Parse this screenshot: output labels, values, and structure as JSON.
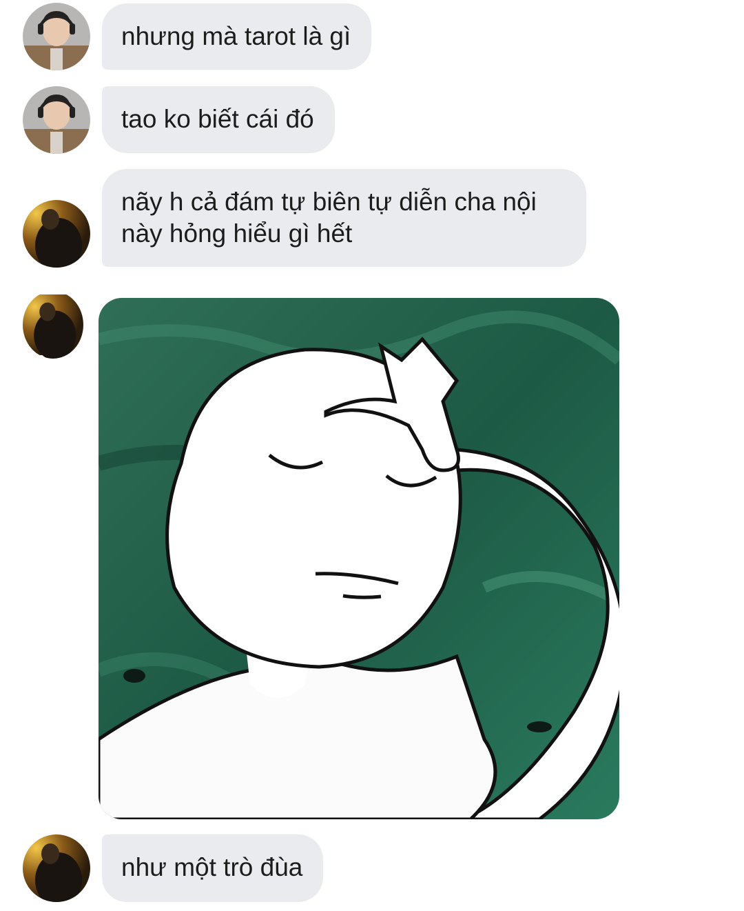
{
  "messages": [
    {
      "sender": "friend",
      "text": "nhưng mà tarot là gì"
    },
    {
      "sender": "friend",
      "text": "tao ko biết cái đó"
    },
    {
      "sender": "self",
      "lines": [
        "nãy h cả đám tự biên tự diễn cha nội",
        "này hỏng hiểu gì hết"
      ]
    },
    {
      "sender": "self",
      "type": "sticker",
      "sticker": "facepalm-sticker"
    },
    {
      "sender": "self",
      "text": "như một trò đùa"
    }
  ],
  "colors": {
    "bubble_bg": "#e9ebee",
    "text": "#1c1c1c",
    "sticker_bg": "#1f5a45"
  }
}
